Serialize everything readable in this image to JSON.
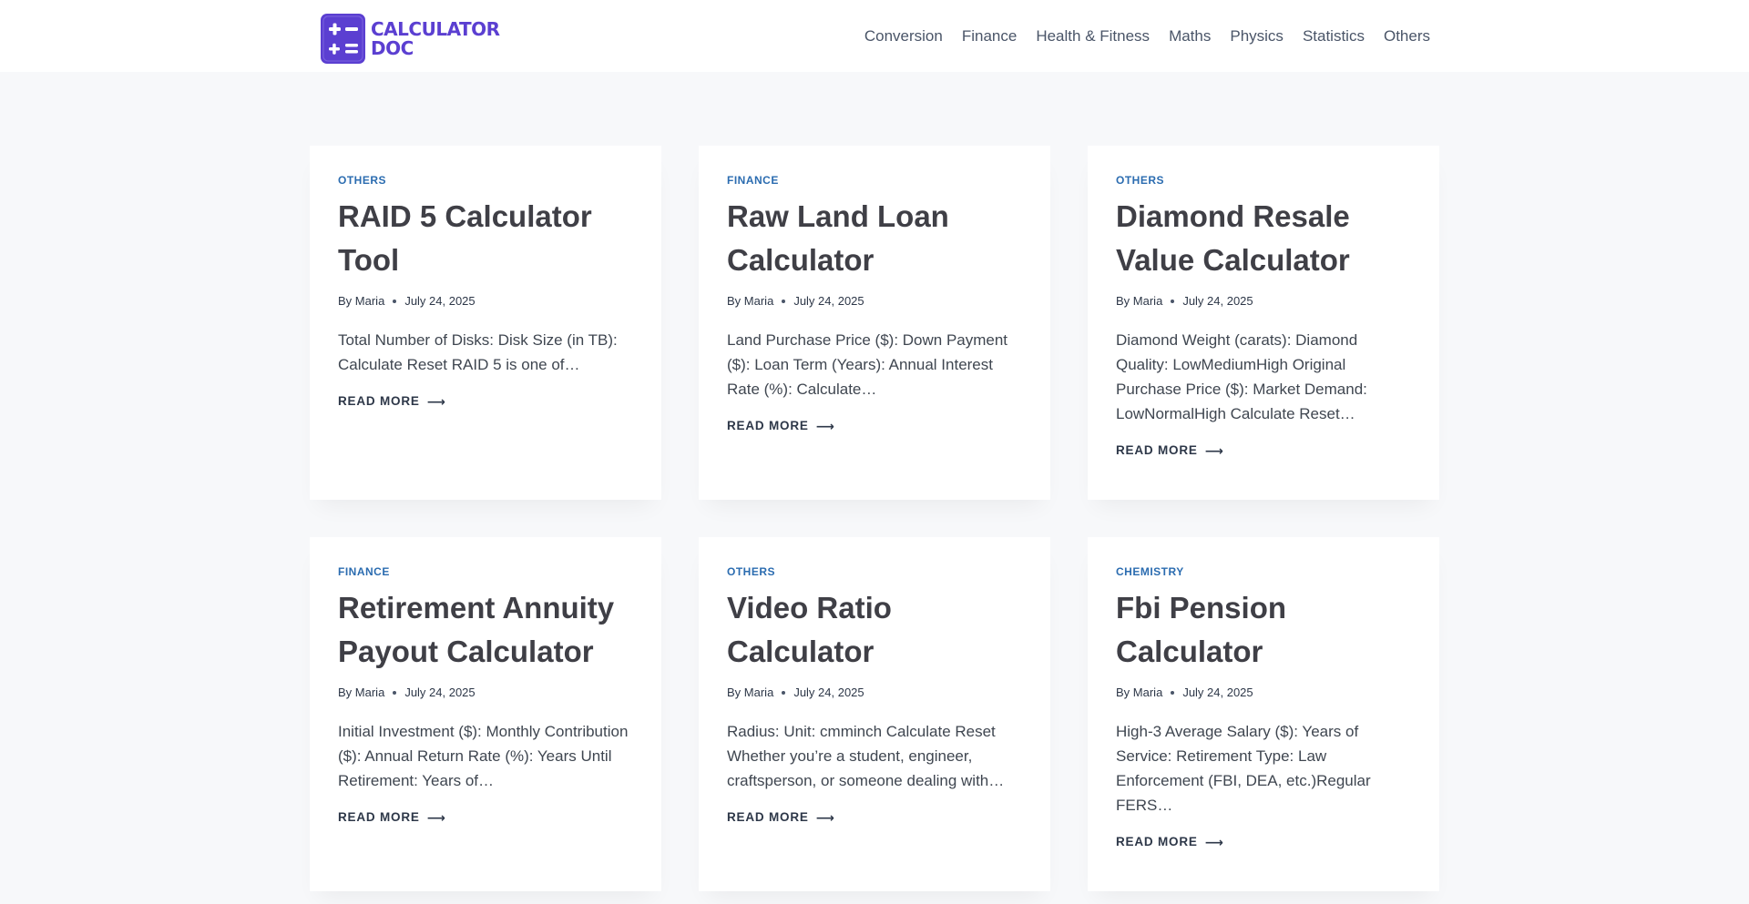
{
  "brand": {
    "line1": "CALCULATOR",
    "line2": "DOC",
    "color": "#5b3fd1"
  },
  "nav": {
    "items": [
      "Conversion",
      "Finance",
      "Health & Fitness",
      "Maths",
      "Physics",
      "Statistics",
      "Others"
    ]
  },
  "posts": [
    {
      "category": "OTHERS",
      "title_lines": [
        "RAID 5 Calculator",
        "Tool"
      ],
      "by": "By",
      "author": "Maria",
      "date": "July 24, 2025",
      "excerpt_lines": [
        "Total Number of Disks: Disk Size (in TB):",
        "Calculate Reset RAID 5 is one of…"
      ],
      "read_more": "READ MORE"
    },
    {
      "category": "FINANCE",
      "title_lines": [
        "Raw Land Loan",
        "Calculator"
      ],
      "by": "By",
      "author": "Maria",
      "date": "July 24, 2025",
      "excerpt_lines": [
        "Land Purchase Price ($): Down Payment",
        "($): Loan Term (Years): Annual Interest",
        "Rate (%): Calculate…"
      ],
      "read_more": "READ MORE"
    },
    {
      "category": "OTHERS",
      "title_lines": [
        "Diamond Resale",
        "Value Calculator"
      ],
      "by": "By",
      "author": "Maria",
      "date": "July 24, 2025",
      "excerpt_lines": [
        "Diamond Weight (carats): Diamond",
        "Quality: LowMediumHigh Original",
        "Purchase Price ($): Market Demand:",
        "LowNormalHigh Calculate Reset…"
      ],
      "read_more": "READ MORE"
    },
    {
      "category": "FINANCE",
      "title_lines": [
        "Retirement Annuity",
        "Payout Calculator"
      ],
      "by": "By",
      "author": "Maria",
      "date": "July 24, 2025",
      "excerpt_lines": [
        "Initial Investment ($): Monthly Contribution",
        "($): Annual Return Rate (%): Years Until",
        "Retirement: Years of…"
      ],
      "read_more": "READ MORE"
    },
    {
      "category": "OTHERS",
      "title_lines": [
        "Video Ratio",
        "Calculator"
      ],
      "by": "By",
      "author": "Maria",
      "date": "July 24, 2025",
      "excerpt_lines": [
        "Radius: Unit: cmminch Calculate Reset",
        "Whether you’re a student, engineer,",
        "craftsperson, or someone dealing with…"
      ],
      "read_more": "READ MORE"
    },
    {
      "category": "CHEMISTRY",
      "title_lines": [
        "Fbi Pension",
        "Calculator"
      ],
      "by": "By",
      "author": "Maria",
      "date": "July 24, 2025",
      "excerpt_lines": [
        "High-3 Average Salary ($): Years of",
        "Service: Retirement Type: Law",
        "Enforcement (FBI, DEA, etc.)Regular",
        "FERS…"
      ],
      "read_more": "READ MORE"
    }
  ]
}
